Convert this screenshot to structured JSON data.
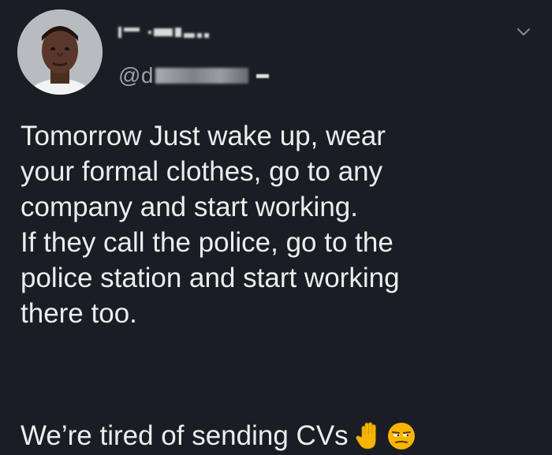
{
  "tweet": {
    "display_name_obscured": true,
    "handle_prefix": "@d",
    "handle_obscured": true,
    "body_lines": [
      "Tomorrow Just wake up, wear",
      "your formal clothes, go to any",
      "company and start working.",
      "If they call the police, go to the",
      "police station and start working",
      "there too."
    ],
    "final_line": "We’re tired of sending CVs",
    "emojis": [
      "raised-hand-icon",
      "unamused-face-icon"
    ],
    "more_icon": "chevron-down-icon"
  },
  "colors": {
    "background": "#1a1d24",
    "text": "#eceded",
    "secondary_text": "#9aa0a6",
    "emoji_yellow": "#f7b500"
  }
}
